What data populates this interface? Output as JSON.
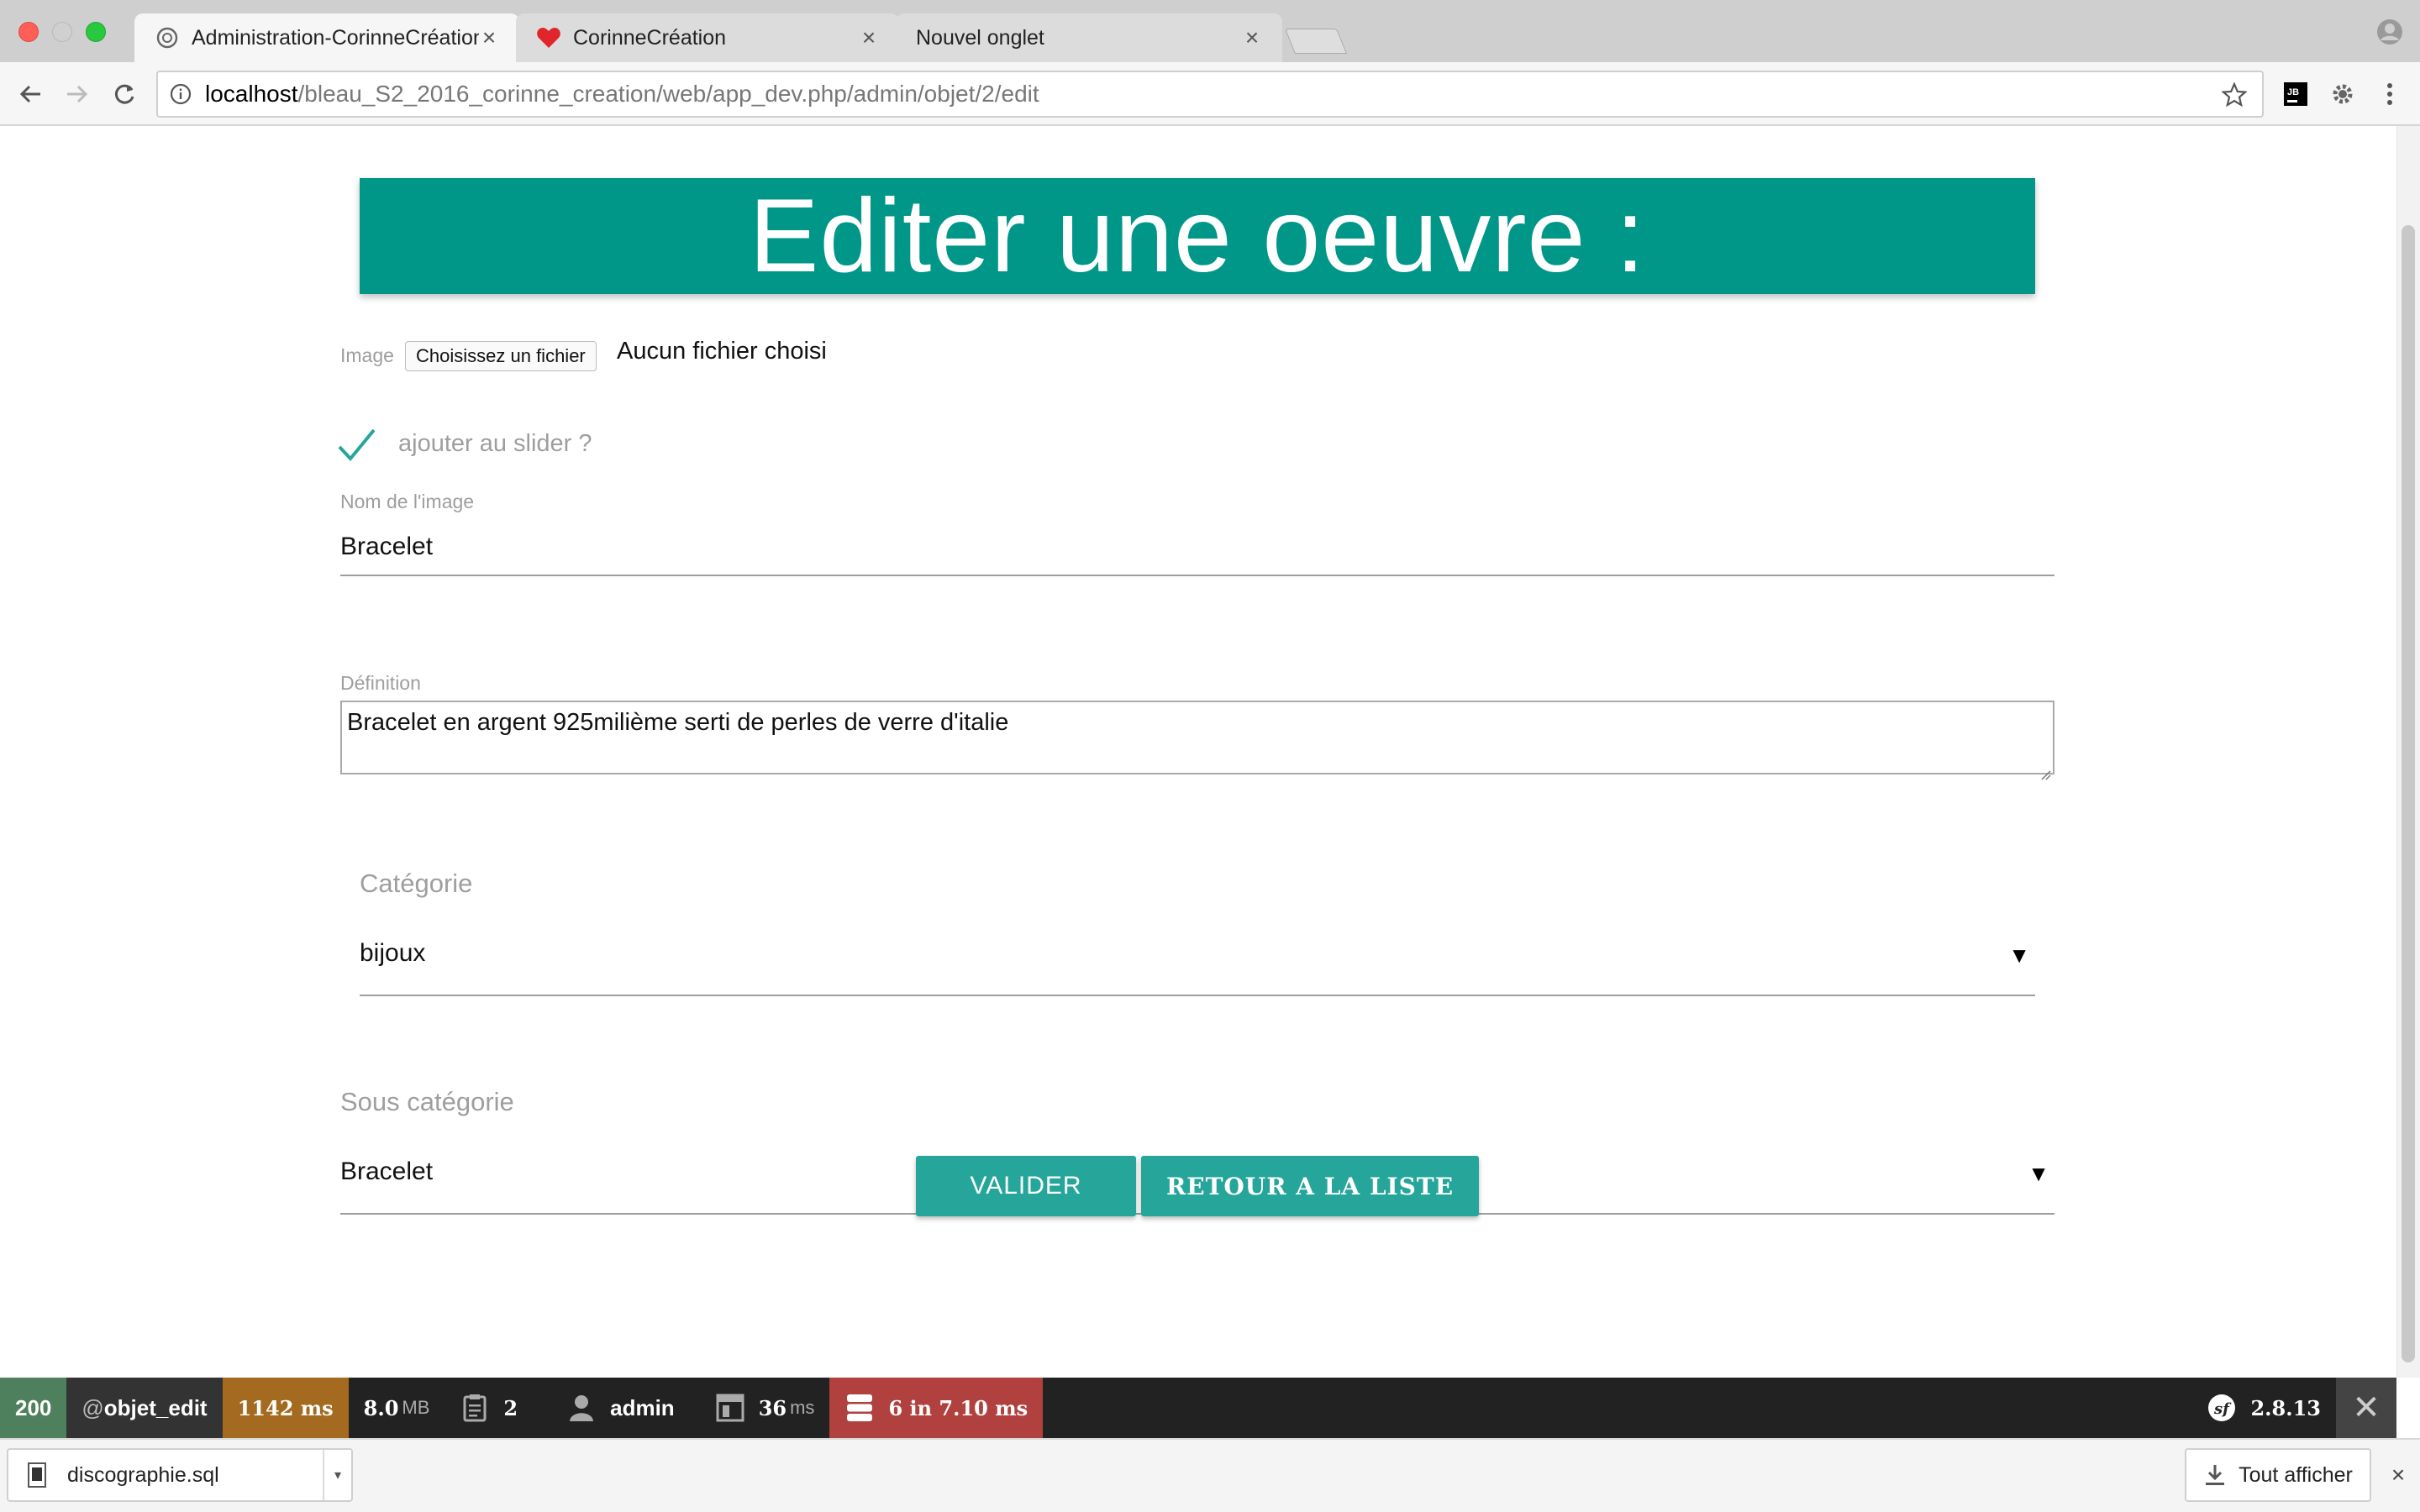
{
  "browser": {
    "tabs": [
      {
        "title": "Administration-CorinneCréation",
        "icon": "globe-icon",
        "active": true
      },
      {
        "title": "CorinneCréation",
        "icon": "heart-icon",
        "active": false
      },
      {
        "title": "Nouvel onglet",
        "icon": "",
        "active": false
      }
    ],
    "url": {
      "host": "localhost",
      "path": "/bleau_S2_2016_corinne_creation/web/app_dev.php/admin/objet/2/edit"
    }
  },
  "page": {
    "heading": "Editer une oeuvre :",
    "image_field": {
      "label": "Image",
      "button_label": "Choisissez un fichier",
      "status": "Aucun fichier choisi"
    },
    "slider_checkbox": {
      "label": "ajouter au slider ?",
      "checked": true
    },
    "nom": {
      "label": "Nom de l'image",
      "value": "Bracelet"
    },
    "definition": {
      "label": "Définition",
      "value": "Bracelet en argent 925milième serti de perles de verre d'italie"
    },
    "categorie": {
      "label": "Catégorie",
      "value": "bijoux"
    },
    "sous_categorie": {
      "label": "Sous catégorie",
      "value": "Bracelet"
    },
    "buttons": {
      "submit": "VALIDER",
      "back": "RETOUR A LA LISTE"
    },
    "colors": {
      "banner": "#009688",
      "button": "#26a69a"
    }
  },
  "debug_bar": {
    "status": "200",
    "route_prefix": "@",
    "route": "objet_edit",
    "time": "1142 ms",
    "memory_value": "8.0",
    "memory_unit": "MB",
    "forms": "2",
    "user": "admin",
    "render_value": "36",
    "render_unit": "ms",
    "db": "6 in 7.10 ms",
    "version": "2.8.13"
  },
  "downloads": {
    "file": "discographie.sql",
    "show_all": "Tout afficher"
  }
}
